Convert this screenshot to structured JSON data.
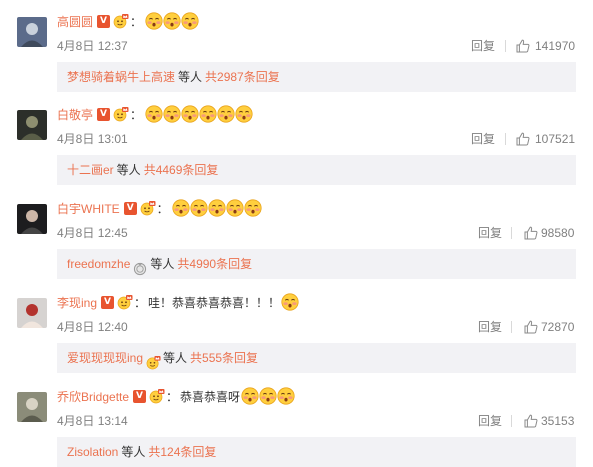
{
  "comments": [
    {
      "username": "高圆圆",
      "text": "",
      "emoji_count": 3,
      "date": "4月8日",
      "time": "12:37",
      "reply_label": "回复",
      "likes": "141970",
      "sub_user": "梦想骑着蜗牛上高速",
      "sub_between": "等人",
      "sub_count": "共2987条回复",
      "sub_badge": "none"
    },
    {
      "username": "白敬亭",
      "text": "",
      "emoji_count": 6,
      "date": "4月8日",
      "time": "13:01",
      "reply_label": "回复",
      "likes": "107521",
      "sub_user": "十二画er",
      "sub_between": "等人",
      "sub_count": "共4469条回复",
      "sub_badge": "none"
    },
    {
      "username": "白宇WHITE",
      "text": "",
      "emoji_count": 5,
      "date": "4月8日",
      "time": "12:45",
      "reply_label": "回复",
      "likes": "98580",
      "sub_user": "freedomzhe",
      "sub_between": "等人",
      "sub_count": "共4990条回复",
      "sub_badge": "medal"
    },
    {
      "username": "李现ing",
      "text": "哇！恭喜恭喜恭喜！！！",
      "emoji_count": 1,
      "date": "4月8日",
      "time": "12:40",
      "reply_label": "回复",
      "likes": "72870",
      "sub_user": "爱现现现现ing",
      "sub_between": "等人",
      "sub_count": "共555条回复",
      "sub_badge": "crown"
    },
    {
      "username": "乔欣Bridgette",
      "text": "恭喜恭喜呀",
      "emoji_count": 3,
      "date": "4月8日",
      "time": "13:14",
      "reply_label": "回复",
      "likes": "35153",
      "sub_user": "Zisolation",
      "sub_between": "等人",
      "sub_count": "共124条回复",
      "sub_badge": "none"
    }
  ],
  "icons": {
    "verified": "V",
    "crown_badge": "crown-badge-icon",
    "emoji": "blushing-face-icon",
    "like": "thumbs-up-icon"
  },
  "colors": {
    "username": "#eb7350",
    "meta": "#808080",
    "subbox_bg": "#f2f2f5",
    "verified_badge": "#e8542f"
  }
}
